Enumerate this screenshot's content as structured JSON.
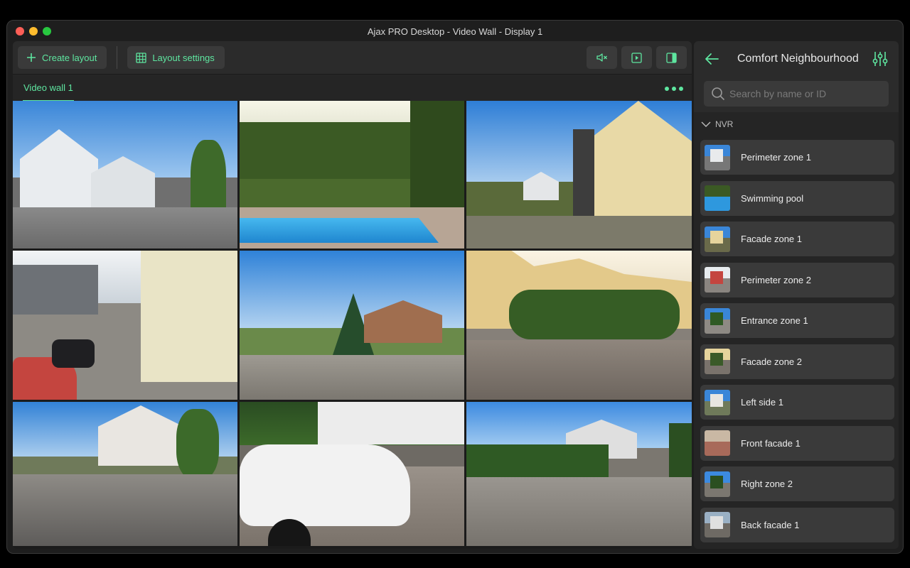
{
  "window": {
    "title": "Ajax PRO Desktop - Video Wall - Display 1"
  },
  "toolbar": {
    "create_layout_label": "Create layout",
    "layout_settings_label": "Layout settings",
    "icons": [
      "mute-icon",
      "play-icon",
      "panel-toggle-icon"
    ]
  },
  "tabs": [
    {
      "label": "Video wall 1",
      "active": true
    }
  ],
  "colors": {
    "accent": "#5ee6a0",
    "surface": "#2b2b2b",
    "item": "#3a3a3a"
  },
  "cameras": [
    {
      "scene": "houses-street-blue-sky"
    },
    {
      "scene": "garden-pool-sun-glare"
    },
    {
      "scene": "modern-house-gable"
    },
    {
      "scene": "side-walkway-parked-cars"
    },
    {
      "scene": "park-fir-tree-fountain"
    },
    {
      "scene": "terrace-houses-courtyard"
    },
    {
      "scene": "curved-street-houses"
    },
    {
      "scene": "driveway-white-suv"
    },
    {
      "scene": "long-paved-lane-hedge"
    }
  ],
  "sidebar": {
    "title": "Comfort Neighbourhood",
    "search": {
      "placeholder": "Search by name or ID",
      "value": ""
    },
    "group": {
      "label": "NVR",
      "expanded": true
    },
    "items": [
      {
        "label": "Perimeter zone 1"
      },
      {
        "label": "Swimming pool"
      },
      {
        "label": "Facade zone 1"
      },
      {
        "label": "Perimeter zone 2"
      },
      {
        "label": "Entrance zone 1"
      },
      {
        "label": "Facade zone 2"
      },
      {
        "label": "Left side 1"
      },
      {
        "label": "Front facade 1"
      },
      {
        "label": "Right zone 2"
      },
      {
        "label": "Back facade 1"
      }
    ]
  }
}
